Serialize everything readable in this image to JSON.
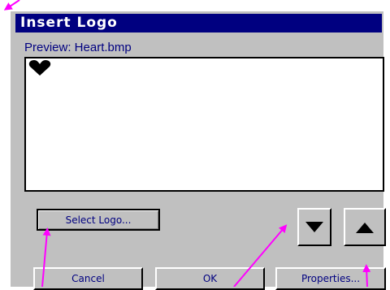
{
  "window": {
    "title": "Insert Logo"
  },
  "preview": {
    "label": "Preview: Heart.bmp",
    "image_icon": "heart-icon"
  },
  "buttons": {
    "select_logo": "Select Logo...",
    "scroll_down_icon": "triangle-down-icon",
    "scroll_up_icon": "triangle-up-icon",
    "cancel": "Cancel",
    "ok": "OK",
    "properties": "Properties..."
  },
  "colors": {
    "title_bar": "#000080",
    "dialog_bg": "#c0c0c0",
    "annotation_arrows": "#ff00ff"
  }
}
